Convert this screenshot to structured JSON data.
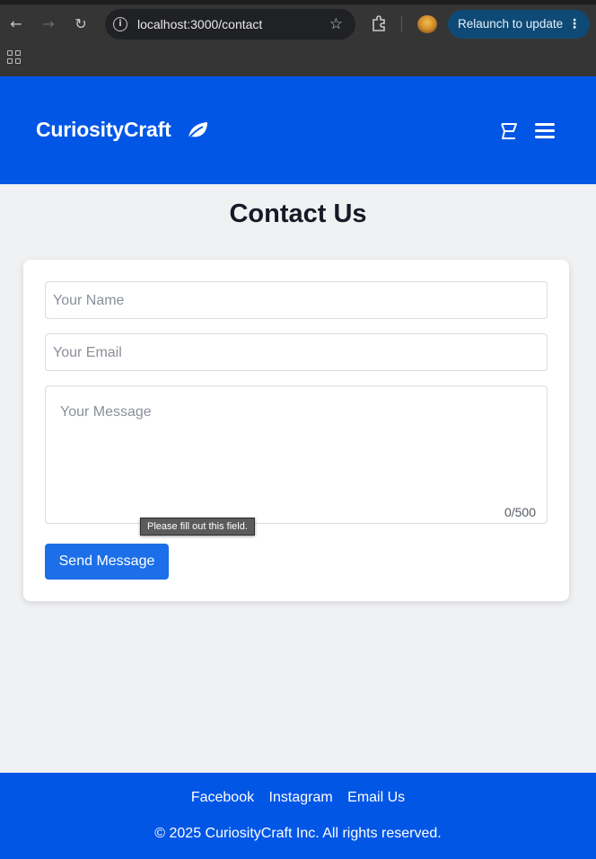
{
  "browser": {
    "url": "localhost:3000/contact",
    "relaunch_label": "Relaunch to update"
  },
  "header": {
    "brand": "CuriosityCraft"
  },
  "main": {
    "title": "Contact Us",
    "form": {
      "name_placeholder": "Your Name",
      "email_placeholder": "Your Email",
      "message_placeholder": "Your Message",
      "char_count": "0/500",
      "validation_tooltip": "Please fill out this field.",
      "submit_label": "Send Message"
    }
  },
  "footer": {
    "links": [
      "Facebook",
      "Instagram",
      "Email Us"
    ],
    "copyright": "© 2025 CuriosityCraft Inc. All rights reserved."
  },
  "colors": {
    "brand_blue": "#0156e6",
    "button_blue": "#1c6fe8",
    "page_bg": "#f0f1f3"
  }
}
